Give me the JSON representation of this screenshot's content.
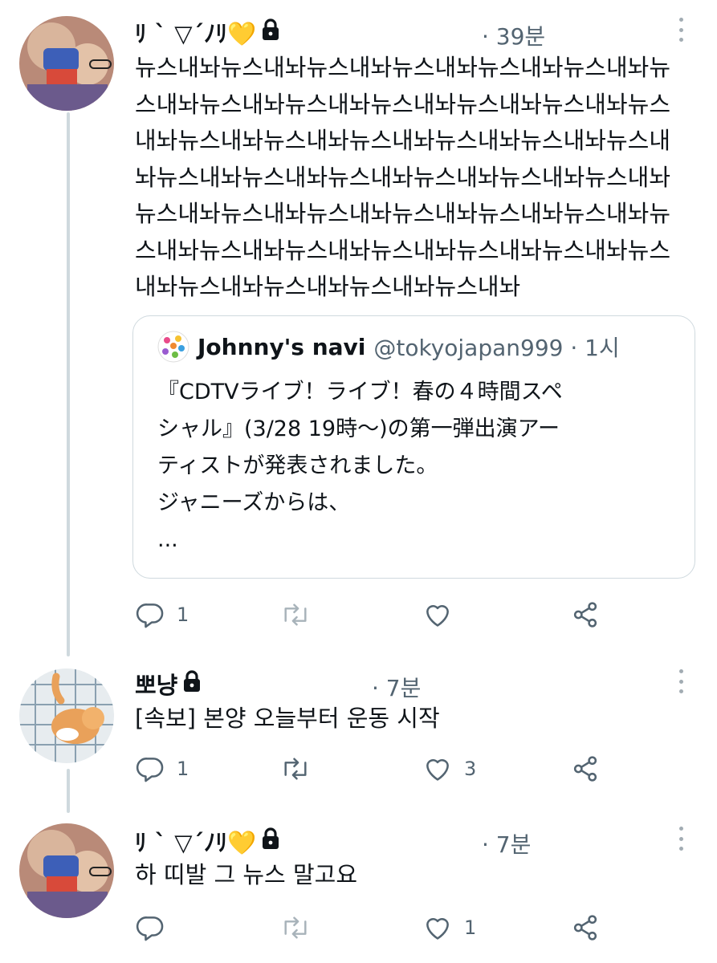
{
  "tweets": [
    {
      "name": "ﾘ ` ▽´ﾉﾘ💛",
      "time": "· 39분",
      "text": "뉴스내놔뉴스내놔뉴스내놔뉴스내놔뉴스내놔뉴스내놔뉴스내놔뉴스내놔뉴스내놔뉴스내놔뉴스내놔뉴스내놔뉴스내놔뉴스내놔뉴스내놔뉴스내놔뉴스내놔뉴스내놔뉴스내놔뉴스내놔뉴스내놔뉴스내놔뉴스내놔뉴스내놔뉴스내놔뉴스내놔뉴스내놔뉴스내놔뉴스내놔뉴스내놔뉴스내놔뉴스내놔뉴스내놔뉴스내놔뉴스내놔뉴스내놔뉴스내놔뉴스내놔뉴스내놔뉴스내놔뉴스내놔뉴스내놔",
      "quote": {
        "name": "Johnny's navi",
        "handle": "@tokyojapan999 · 1시",
        "lines": [
          "『CDTVライブ！ライブ！春の４時間スペ",
          "シャル』(3/28 19時〜)の第一弾出演アー",
          "ティストが発表されました。",
          "ジャニーズからは、",
          "..."
        ]
      },
      "replies": "1",
      "retweets": "",
      "likes": ""
    },
    {
      "name": "뽀냥",
      "time": "· 7분",
      "text": "[속보] 본양 오늘부터 운동 시작",
      "replies": "1",
      "retweets": "",
      "likes": "3"
    },
    {
      "name": "ﾘ ` ▽´ﾉﾘ💛",
      "time": "· 7분",
      "text": "하 띠발 그 뉴스 말고요",
      "replies": "",
      "retweets": "",
      "likes": "1"
    }
  ],
  "icons": {
    "reply": "reply-icon",
    "retweet": "retweet-icon",
    "like": "heart-icon",
    "share": "share-icon",
    "lock": "lock-icon",
    "more": "more-icon"
  },
  "colors": {
    "text": "#0f1419",
    "muted": "#536471",
    "border": "#cfd9de",
    "thread_line": "#cfd9de"
  }
}
